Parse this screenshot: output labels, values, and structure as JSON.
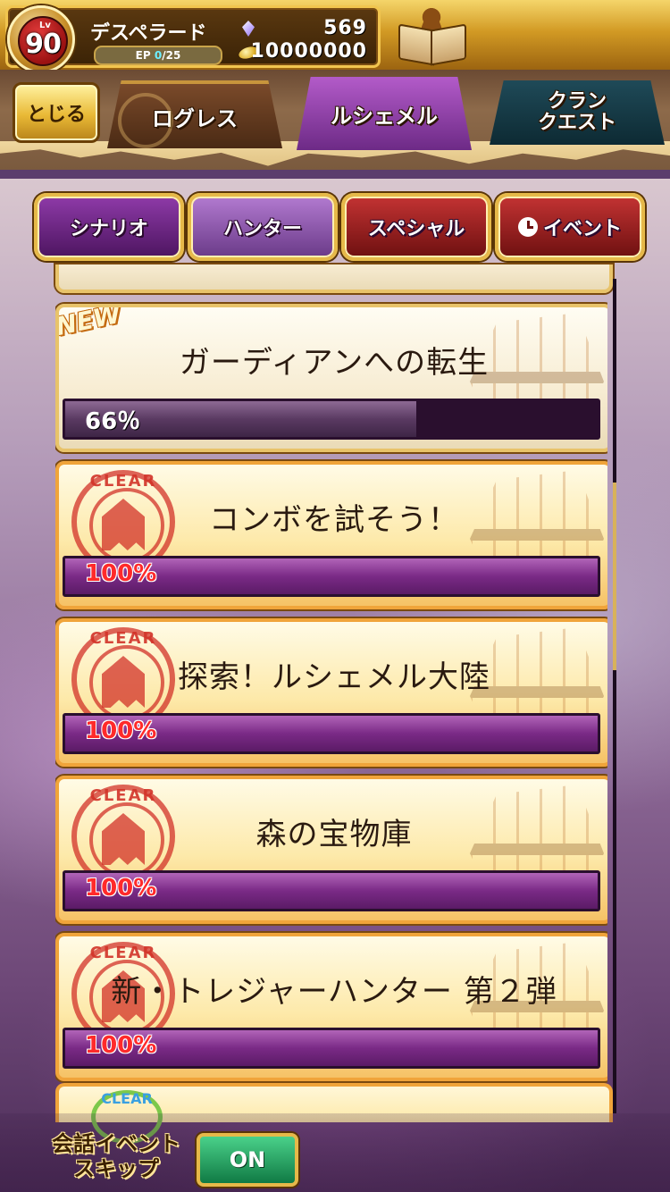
{
  "header": {
    "level_label": "Lv",
    "level": "90",
    "player_name": "デスペラード",
    "ep_label": "EP",
    "ep_current": "0",
    "ep_max": "/25",
    "gems": "569",
    "coins": "10000000"
  },
  "tabs": {
    "close_label": "とじる",
    "regions": [
      {
        "label": "ログレス"
      },
      {
        "label": "ルシェメル"
      },
      {
        "label_line1": "クラン",
        "label_line2": "クエスト"
      }
    ],
    "active_region": "ルシェメル"
  },
  "categories": [
    {
      "label": "シナリオ"
    },
    {
      "label": "ハンター"
    },
    {
      "label": "スペシャル"
    },
    {
      "label": "イベント"
    }
  ],
  "quests": [
    {
      "title": "ガーディアンへの転生",
      "progress_text": "66％",
      "progress": 0.66,
      "badge": "NEW",
      "cleared": false
    },
    {
      "title": "コンボを試そう！",
      "progress_text": "100%",
      "progress": 1.0,
      "stamp": "CLEAR",
      "cleared": true
    },
    {
      "title": "探索！ルシェメル大陸",
      "progress_text": "100%",
      "progress": 1.0,
      "stamp": "CLEAR",
      "cleared": true
    },
    {
      "title": "森の宝物庫",
      "progress_text": "100%",
      "progress": 1.0,
      "stamp": "CLEAR",
      "cleared": true
    },
    {
      "title": "新・トレジャーハンター 第２弾",
      "progress_text": "100%",
      "progress": 1.0,
      "stamp": "CLEAR",
      "cleared": true
    }
  ],
  "partial_next": {
    "stamp": "CLEAR"
  },
  "footer": {
    "skip_line1": "会話イベント",
    "skip_line2": "スキップ",
    "toggle_label": "ON"
  },
  "colors": {
    "gold": "#e6b949",
    "active_tab": "#b35bc9",
    "clear_stamp": "#d23228",
    "toggle_on": "#2fae6a"
  },
  "icons": [
    "gem-icon",
    "coin-icon",
    "quest-book-icon",
    "clock-icon",
    "clear-stamp-icon"
  ]
}
